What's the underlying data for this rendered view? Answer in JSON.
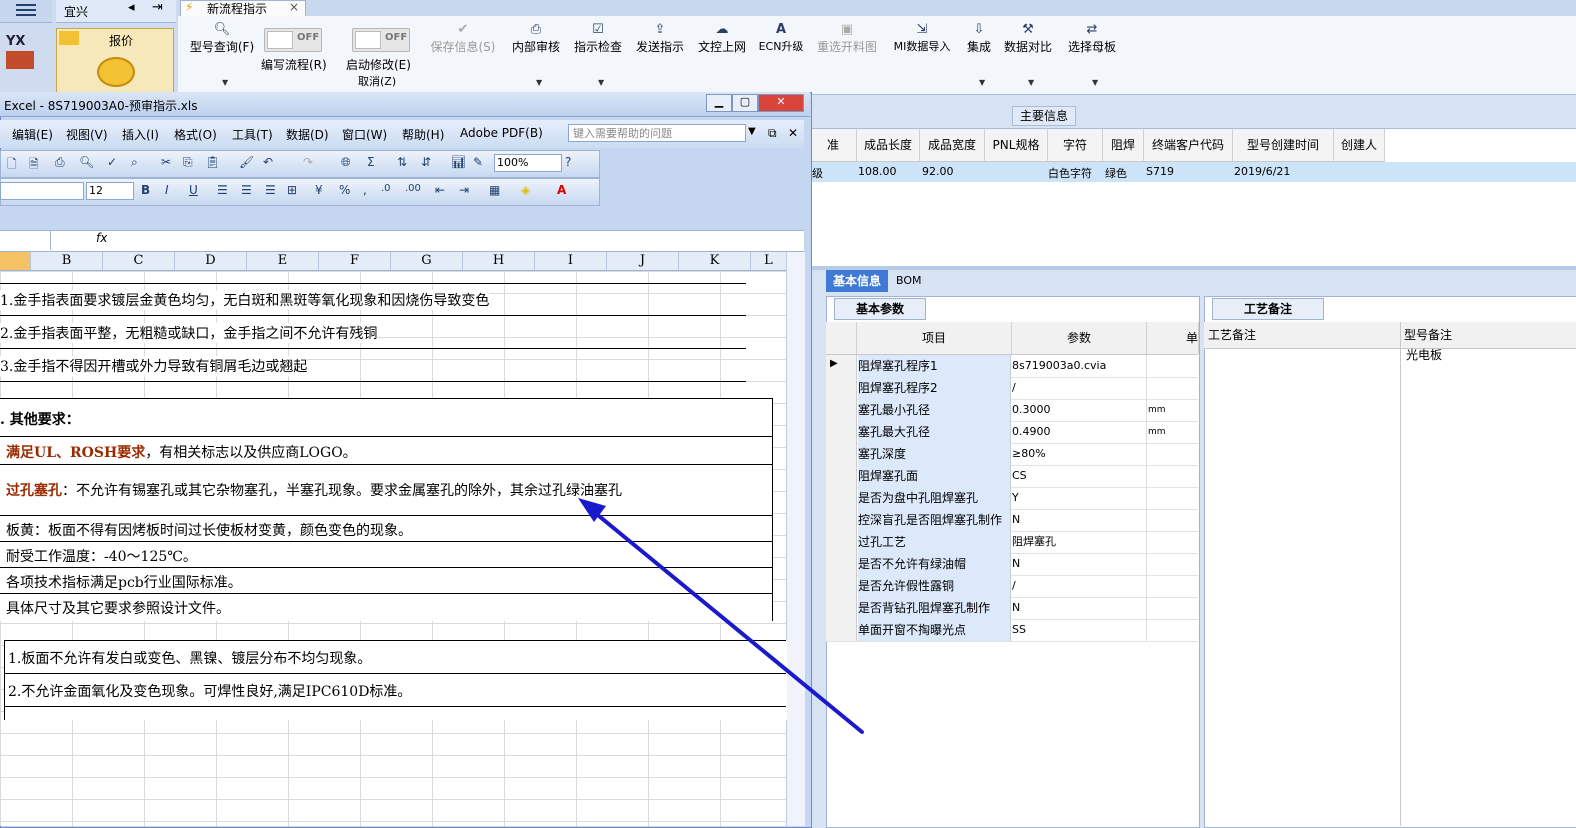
{
  "left_nav": {
    "user": "宜兴",
    "module_tile": "报价",
    "logo_text": "YX"
  },
  "tab": {
    "title": "新流程指示",
    "close": "×"
  },
  "toolbar": {
    "model_query": "型号查询(F)",
    "edit_flow": "编写流程(R)",
    "edit_flow_state": "OFF",
    "start_modify": "启动修改(E)",
    "start_modify_state": "OFF",
    "cancel": "取消(Z)",
    "save_info": "保存信息(S)",
    "internal_review": "内部审核",
    "instruction_check": "指示检查",
    "send_instruction": "发送指示",
    "upload_doc": "文控上网",
    "ecn_upgrade": "ECN升级",
    "reselect_chart": "重选开料图",
    "mi_import": "MI数据导入",
    "integrate": "集成",
    "data_compare": "数据对比",
    "select_master": "选择母板"
  },
  "main_info": {
    "section_label": "主要信息",
    "columns": [
      "准",
      "成品长度",
      "成品宽度",
      "PNL规格",
      "字符",
      "阻焊",
      "终端客户代码",
      "型号创建时间",
      "创建人"
    ],
    "row": [
      "级",
      "108.00",
      "92.00",
      "",
      "白色字符",
      "绿色",
      "S719",
      "2019/6/21",
      ""
    ]
  },
  "detail_tabs": {
    "basic": "基本信息",
    "bom": "BOM"
  },
  "basic_params": {
    "title": "基本参数",
    "col_item": "项目",
    "col_param": "参数",
    "col_unit": "单",
    "rows": [
      {
        "k": "阻焊塞孔程序1",
        "v": "8s719003a0.cvia",
        "u": ""
      },
      {
        "k": "阻焊塞孔程序2",
        "v": "/",
        "u": ""
      },
      {
        "k": "塞孔最小孔径",
        "v": "0.3000",
        "u": "mm"
      },
      {
        "k": "塞孔最大孔径",
        "v": "0.4900",
        "u": "mm"
      },
      {
        "k": "塞孔深度",
        "v": "≥80%",
        "u": ""
      },
      {
        "k": "阻焊塞孔面",
        "v": "CS",
        "u": ""
      },
      {
        "k": "是否为盘中孔阻焊塞孔",
        "v": "Y",
        "u": ""
      },
      {
        "k": "控深盲孔是否阻焊塞孔制作",
        "v": "N",
        "u": ""
      },
      {
        "k": "过孔工艺",
        "v": "阻焊塞孔",
        "u": ""
      },
      {
        "k": "是否不允许有绿油帽",
        "v": "N",
        "u": ""
      },
      {
        "k": "是否允许假性露铜",
        "v": "/",
        "u": ""
      },
      {
        "k": "是否背钻孔阻焊塞孔制作",
        "v": "N",
        "u": ""
      },
      {
        "k": "单面开窗不掏曝光点",
        "v": "SS",
        "u": ""
      }
    ]
  },
  "craft_notes": {
    "title": "工艺备注",
    "col_craft": "工艺备注",
    "col_model": "型号备注",
    "model_note": "光电板"
  },
  "excel": {
    "title": "Excel - 8S719003A0-预审指示.xls",
    "menu": [
      "编辑(E)",
      "视图(V)",
      "插入(I)",
      "格式(O)",
      "工具(T)",
      "数据(D)",
      "窗口(W)",
      "帮助(H)",
      "Adobe PDF(B)"
    ],
    "help_placeholder": "键入需要帮助的问题",
    "zoom": "100%",
    "font_size": "12",
    "columns": [
      "B",
      "C",
      "D",
      "E",
      "F",
      "G",
      "H",
      "I",
      "J",
      "K",
      "L"
    ],
    "lines": [
      "1.金手指表面要求镀层金黄色均匀，无白斑和黑斑等氧化现象和因烧伤导致变色",
      "2.金手指表面平整，无粗糙或缺口，金手指之间不允许有残铜",
      "3.金手指不得因开槽或外力导致有铜屑毛边或翘起"
    ],
    "other_req": ". 其他要求：",
    "ul_label": "满足UL、ROSH要求",
    "ul_rest": "，有相关标志以及供应商LOGO。",
    "via_label": "过孔塞孔",
    "via_rest": "：不允许有锡塞孔或其它杂物塞孔，半塞孔现象。要求金属塞孔的除外，其余过孔绿油塞孔",
    "lines2": [
      "板黄：板面不得有因烤板时间过长使板材变黄，颜色变色的现象。",
      "耐受工作温度：-40～125℃。",
      "各项技术指标满足pcb行业国际标准。",
      "具体尺寸及其它要求参照设计文件。"
    ],
    "lines3": [
      "1.板面不允许有发白或变色、黑镍、镀层分布不均匀现象。",
      "2.不允许金面氧化及变色现象。可焊性良好,满足IPC610D标准。"
    ]
  },
  "colors": {
    "accent": "#3f7ad6",
    "arrow": "#1a1acc",
    "highlight_row": "#cde3f8"
  }
}
